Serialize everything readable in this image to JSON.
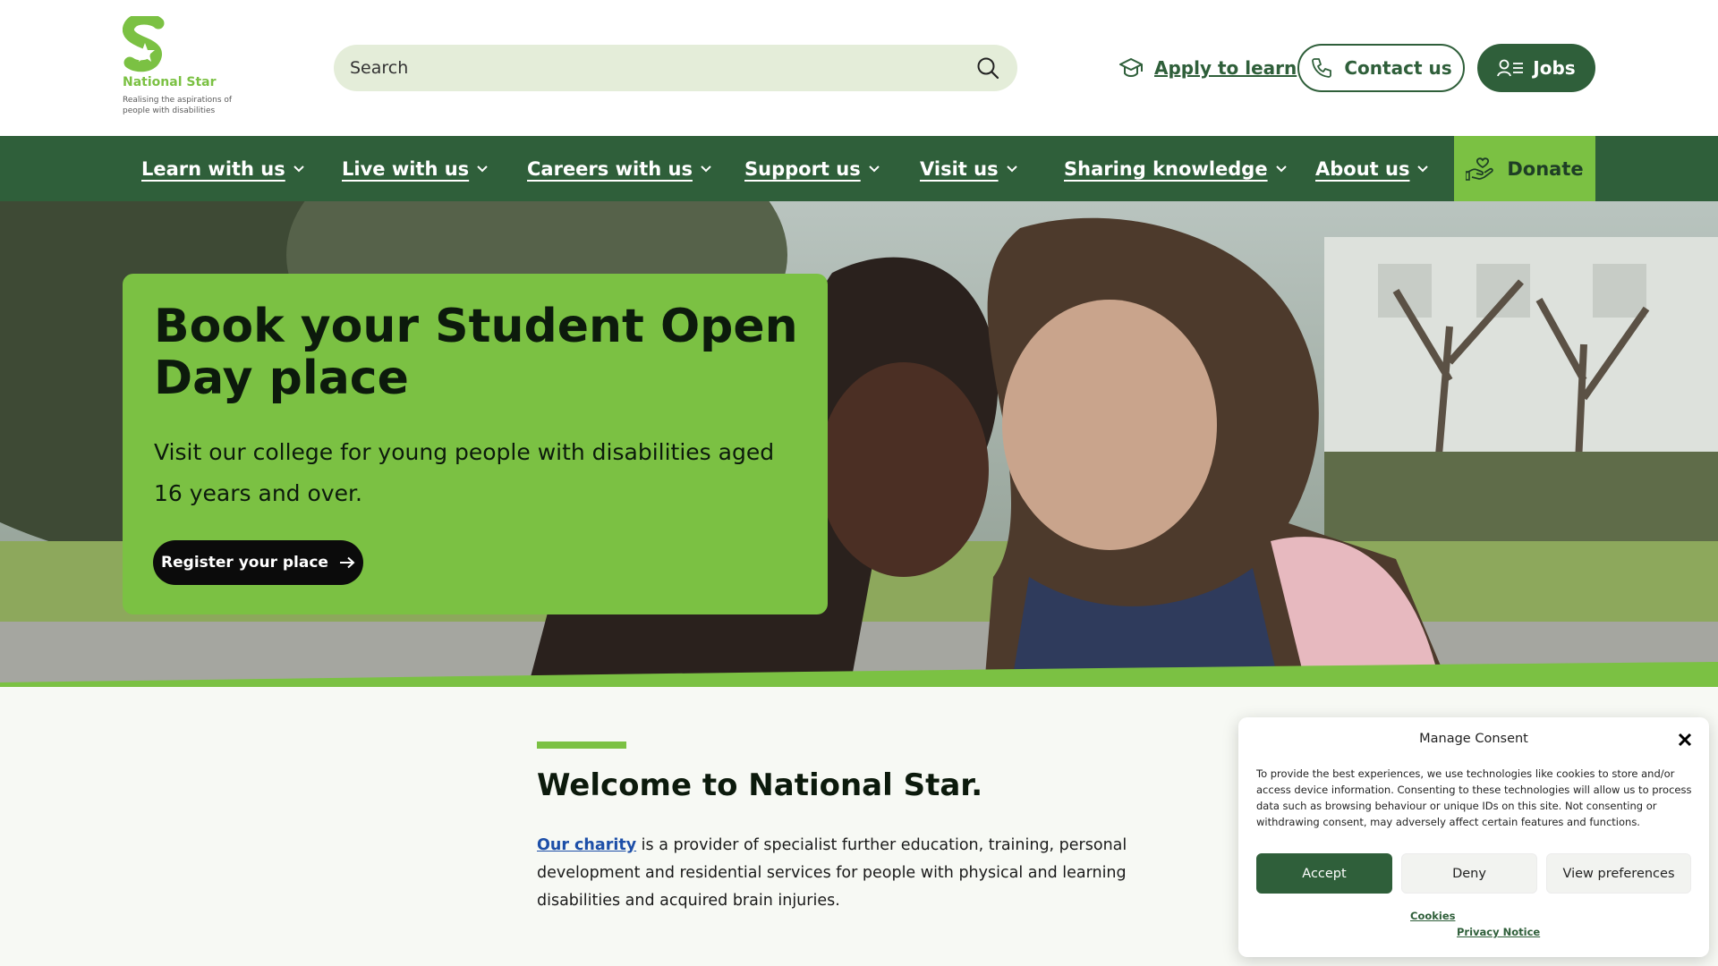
{
  "brand": {
    "name": "National Star",
    "tagline": "Realising the aspirations of people with disabilities",
    "accent_green": "#7bc143",
    "dark_green": "#2f5f3a"
  },
  "header": {
    "search_placeholder": "Search",
    "apply_label": "Apply to learn",
    "contact_label": "Contact us",
    "jobs_label": "Jobs"
  },
  "nav": {
    "items": [
      {
        "label": "Learn with us"
      },
      {
        "label": "Live with us"
      },
      {
        "label": "Careers with us"
      },
      {
        "label": "Support us"
      },
      {
        "label": "Visit us"
      },
      {
        "label": "Sharing knowledge"
      },
      {
        "label": "About us"
      }
    ],
    "donate_label": "Donate"
  },
  "hero": {
    "title": "Book your Student Open Day place",
    "text": "Visit our college for young people with disabilities aged 16 years and over.",
    "button_label": "Register your place"
  },
  "welcome": {
    "title": "Welcome to National Star.",
    "link_text": "Our charity",
    "text": " is a provider of specialist further education, training, personal development and residential services for people with physical and learning disabilities and acquired brain injuries."
  },
  "consent": {
    "title": "Manage Consent",
    "text": "To provide the best experiences, we use technologies like cookies to store and/or access device information. Consenting to these technologies will allow us to process data such as browsing behaviour or unique IDs on this site. Not consenting or withdrawing consent, may adversely affect certain features and functions.",
    "accept_label": "Accept",
    "deny_label": "Deny",
    "prefs_label": "View preferences",
    "cookies_link": "Cookies",
    "privacy_link": "Privacy Notice"
  }
}
